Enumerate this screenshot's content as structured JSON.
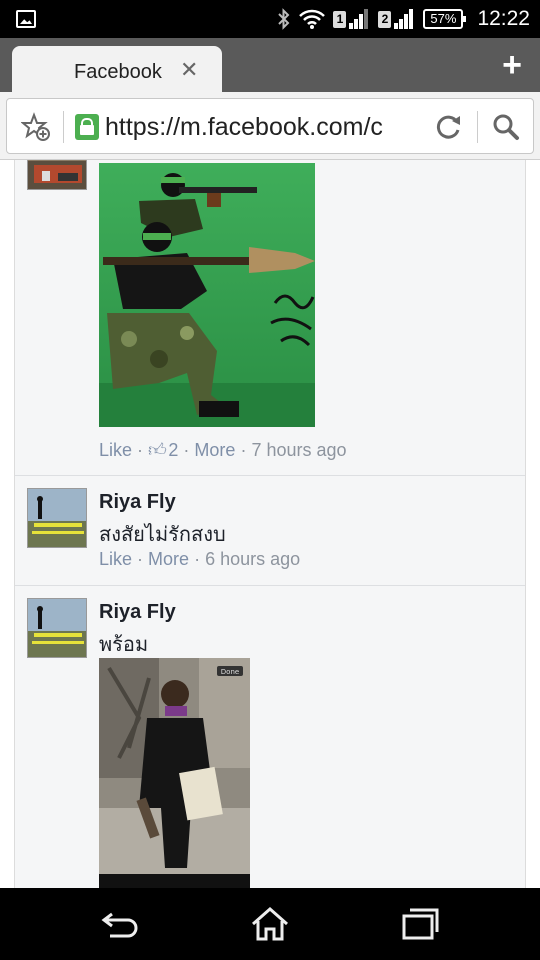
{
  "status_bar": {
    "sim1": "1",
    "sim2": "2",
    "battery": "57%",
    "time": "12:22"
  },
  "browser": {
    "tab_title": "Facebook",
    "url": "https://m.facebook.com/c"
  },
  "comments": [
    {
      "like_label": "Like",
      "like_count": "2",
      "more_label": "More",
      "time": "7 hours ago"
    },
    {
      "name": "Riya Fly",
      "text": "สงสัยไม่รักสงบ",
      "like_label": "Like",
      "more_label": "More",
      "time": "6 hours ago"
    },
    {
      "name": "Riya Fly",
      "text": "พร้อม",
      "photo_badge": "Done"
    }
  ],
  "colors": {
    "link": "#7f8fa8",
    "meta": "#8d949e",
    "feed_bg": "#f5f6f7",
    "secure_lock": "#4caf50"
  }
}
